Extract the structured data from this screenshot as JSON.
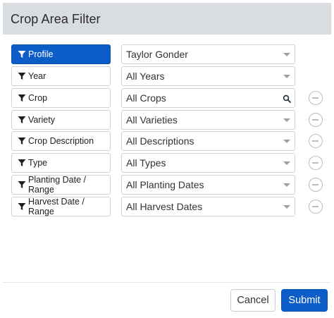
{
  "dialog": {
    "title": "Crop Area Filter"
  },
  "filters": [
    {
      "label": "Profile",
      "value": "Taylor Gonder",
      "active": true,
      "control": "dropdown",
      "removable": false
    },
    {
      "label": "Year",
      "value": "All Years",
      "active": false,
      "control": "dropdown",
      "removable": false
    },
    {
      "label": "Crop",
      "value": "All Crops",
      "active": false,
      "control": "search",
      "removable": true
    },
    {
      "label": "Variety",
      "value": "All Varieties",
      "active": false,
      "control": "dropdown",
      "removable": true
    },
    {
      "label": "Crop Description",
      "value": "All Descriptions",
      "active": false,
      "control": "dropdown",
      "removable": true
    },
    {
      "label": "Type",
      "value": "All Types",
      "active": false,
      "control": "dropdown",
      "removable": true
    },
    {
      "label": "Planting Date / Range",
      "value": "All Planting Dates",
      "active": false,
      "control": "dropdown",
      "removable": true
    },
    {
      "label": "Harvest Date / Range",
      "value": "All Harvest Dates",
      "active": false,
      "control": "dropdown",
      "removable": true
    }
  ],
  "icons": {
    "filter": "funnel-icon",
    "dropdown": "chevron-down-icon",
    "search": "search-icon",
    "remove": "minus-circle-icon"
  },
  "footer": {
    "cancel_label": "Cancel",
    "submit_label": "Submit"
  },
  "colors": {
    "accent": "#0d5dc9",
    "header_bg": "#d9dce1",
    "border": "#cfd3d8"
  }
}
